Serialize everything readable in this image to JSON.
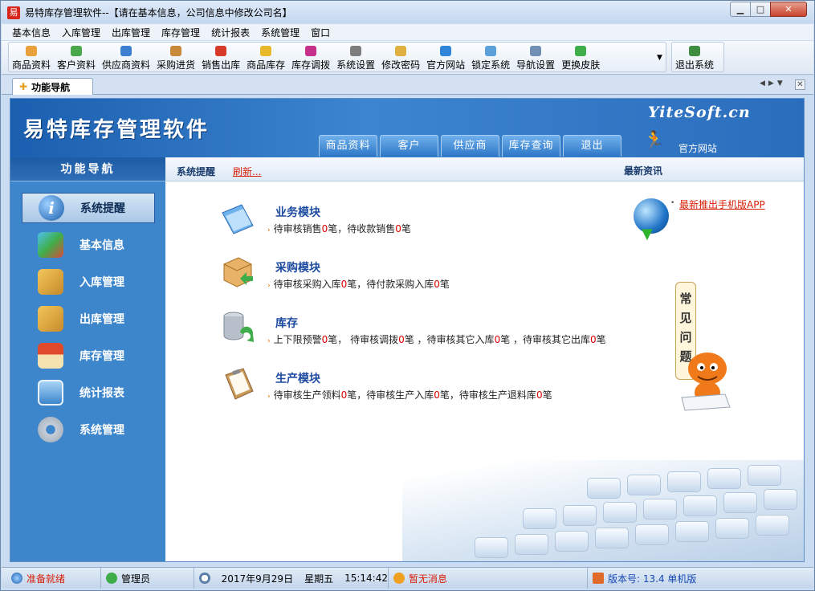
{
  "window": {
    "title": "易特库存管理软件--【请在基本信息，公司信息中修改公司名】",
    "app_icon": "易"
  },
  "menu": [
    "基本信息",
    "入库管理",
    "出库管理",
    "库存管理",
    "统计报表",
    "系统管理",
    "窗口"
  ],
  "toolbar": {
    "items": [
      {
        "label": "商品资料",
        "color": "#e9a23b"
      },
      {
        "label": "客户资料",
        "color": "#4aa84a"
      },
      {
        "label": "供应商资料",
        "color": "#3c7fd1"
      },
      {
        "label": "采购进货",
        "color": "#c88a3a"
      },
      {
        "label": "销售出库",
        "color": "#d83a2a"
      },
      {
        "label": "商品库存",
        "color": "#e6b82a"
      },
      {
        "label": "库存调拨",
        "color": "#c62f8a"
      },
      {
        "label": "系统设置",
        "color": "#7d7d7d"
      },
      {
        "label": "修改密码",
        "color": "#e0b040"
      },
      {
        "label": "官方网站",
        "color": "#2f86d9"
      },
      {
        "label": "锁定系统",
        "color": "#5ba0d8"
      },
      {
        "label": "导航设置",
        "color": "#6f8fb5"
      },
      {
        "label": "更换皮肤",
        "color": "#3fae4a"
      }
    ],
    "exit_label": "退出系统"
  },
  "tab": {
    "label": "功能导航"
  },
  "header": {
    "title": "易特库存管理软件",
    "brand": "YiteSoft.cn",
    "tabs": [
      "商品资料",
      "客户",
      "供应商",
      "库存查询",
      "退出"
    ],
    "official_site": "官方网站"
  },
  "sidebar": {
    "title": "功能导航",
    "items": [
      {
        "label": "系统提醒",
        "color": "#2d6fb8"
      },
      {
        "label": "基本信息",
        "color": "#3aa3d6"
      },
      {
        "label": "入库管理",
        "color": "#e8a73a"
      },
      {
        "label": "出库管理",
        "color": "#e8a73a"
      },
      {
        "label": "库存管理",
        "color": "#d65a2a"
      },
      {
        "label": "统计报表",
        "color": "#5a9fd8"
      },
      {
        "label": "系统管理",
        "color": "#9aa7b5"
      }
    ]
  },
  "main": {
    "title": "系统提醒",
    "refresh": "刷新...",
    "news_title": "最新资讯",
    "modules": [
      {
        "title": "业务模块",
        "lines": [
          [
            "待审核销售",
            "0",
            "笔，待收款销售",
            "0",
            "笔"
          ]
        ]
      },
      {
        "title": "采购模块",
        "lines": [
          [
            "待审核采购入库",
            "0",
            "笔，待付款采购入库",
            "0",
            "笔"
          ]
        ]
      },
      {
        "title": "库存",
        "lines": [
          [
            "上下限预警",
            "0",
            "笔，  待审核调拨",
            "0",
            "笔 ，待审核其它入库",
            "0",
            "笔 ，待审核其它出库",
            "0",
            "笔"
          ]
        ]
      },
      {
        "title": "生产模块",
        "lines": [
          [
            "待审核生产领料",
            "0",
            "笔，待审核生产入库",
            "0",
            "笔，待审核生产退料库",
            "0",
            "笔"
          ]
        ]
      }
    ],
    "news_item": "最新推出手机版APP",
    "faq": "常见问题"
  },
  "status": {
    "ready": "准备就绪",
    "user": "管理员",
    "date": "2017年9月29日",
    "weekday": "星期五",
    "time": "15:14:42",
    "message": "暂无消息",
    "version": "版本号: 13.4 单机版"
  }
}
